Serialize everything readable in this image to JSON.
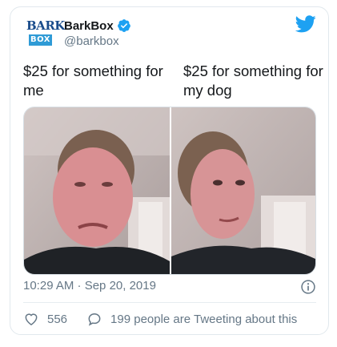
{
  "tweet": {
    "display_name": "BarkBox",
    "handle": "@barkbox",
    "verified": true,
    "avatar": {
      "logo_top": "BARK",
      "logo_bottom": "BOX"
    },
    "captions": {
      "left": "$25 for something for me",
      "right": "$25 for something for my dog"
    },
    "timestamp": "10:29 AM · Sep 20, 2019",
    "likes": "556",
    "conversation_text": "199 people are Tweeting about this"
  },
  "icons": {
    "brand": "twitter-bird-icon",
    "verified": "verified-badge-icon",
    "info": "info-icon",
    "like": "heart-icon",
    "reply": "reply-bubble-icon"
  },
  "colors": {
    "text": "#14171a",
    "secondary": "#657786",
    "twitter_blue": "#1da1f2",
    "border": "#e1e8ed"
  }
}
